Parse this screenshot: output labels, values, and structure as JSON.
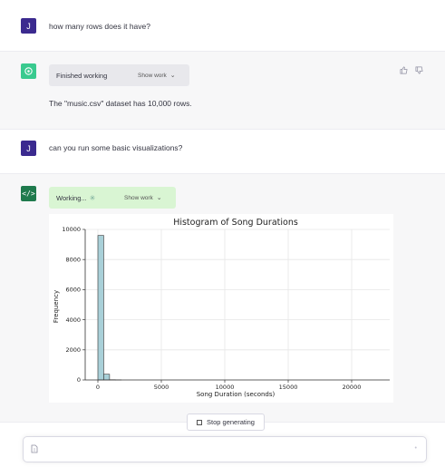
{
  "messages": {
    "user1": {
      "avatar": "J",
      "text": "how many rows does it have?"
    },
    "assistant1": {
      "avatar_icon": "openai-logo-icon",
      "work_label": "Finished working",
      "show_work": "Show work",
      "text": "The \"music.csv\" dataset has 10,000 rows."
    },
    "user2": {
      "avatar": "J",
      "text": "can you run some basic visualizations?"
    },
    "assistant2": {
      "avatar_icon": "code-icon",
      "avatar_glyph": "</>",
      "work_label": "Working...",
      "show_work": "Show work"
    }
  },
  "feedback": {
    "up": "👍",
    "down": "👎"
  },
  "chart_data": {
    "type": "bar",
    "title": "Histogram of Song Durations",
    "xlabel": "Song Duration (seconds)",
    "ylabel": "Frequency",
    "xlim": [
      -1000,
      23000
    ],
    "ylim": [
      0,
      10000
    ],
    "xticks": [
      0,
      5000,
      10000,
      15000,
      20000
    ],
    "yticks": [
      0,
      2000,
      4000,
      6000,
      8000,
      10000
    ],
    "bin_width": 460,
    "bins": [
      {
        "x0": 0,
        "value": 9600
      },
      {
        "x0": 460,
        "value": 380
      },
      {
        "x0": 920,
        "value": 15
      },
      {
        "x0": 1380,
        "value": 4
      }
    ],
    "grid": true,
    "bar_color": "#a9d0d8"
  },
  "controls": {
    "stop_label": "Stop generating",
    "composer_placeholder": ""
  }
}
